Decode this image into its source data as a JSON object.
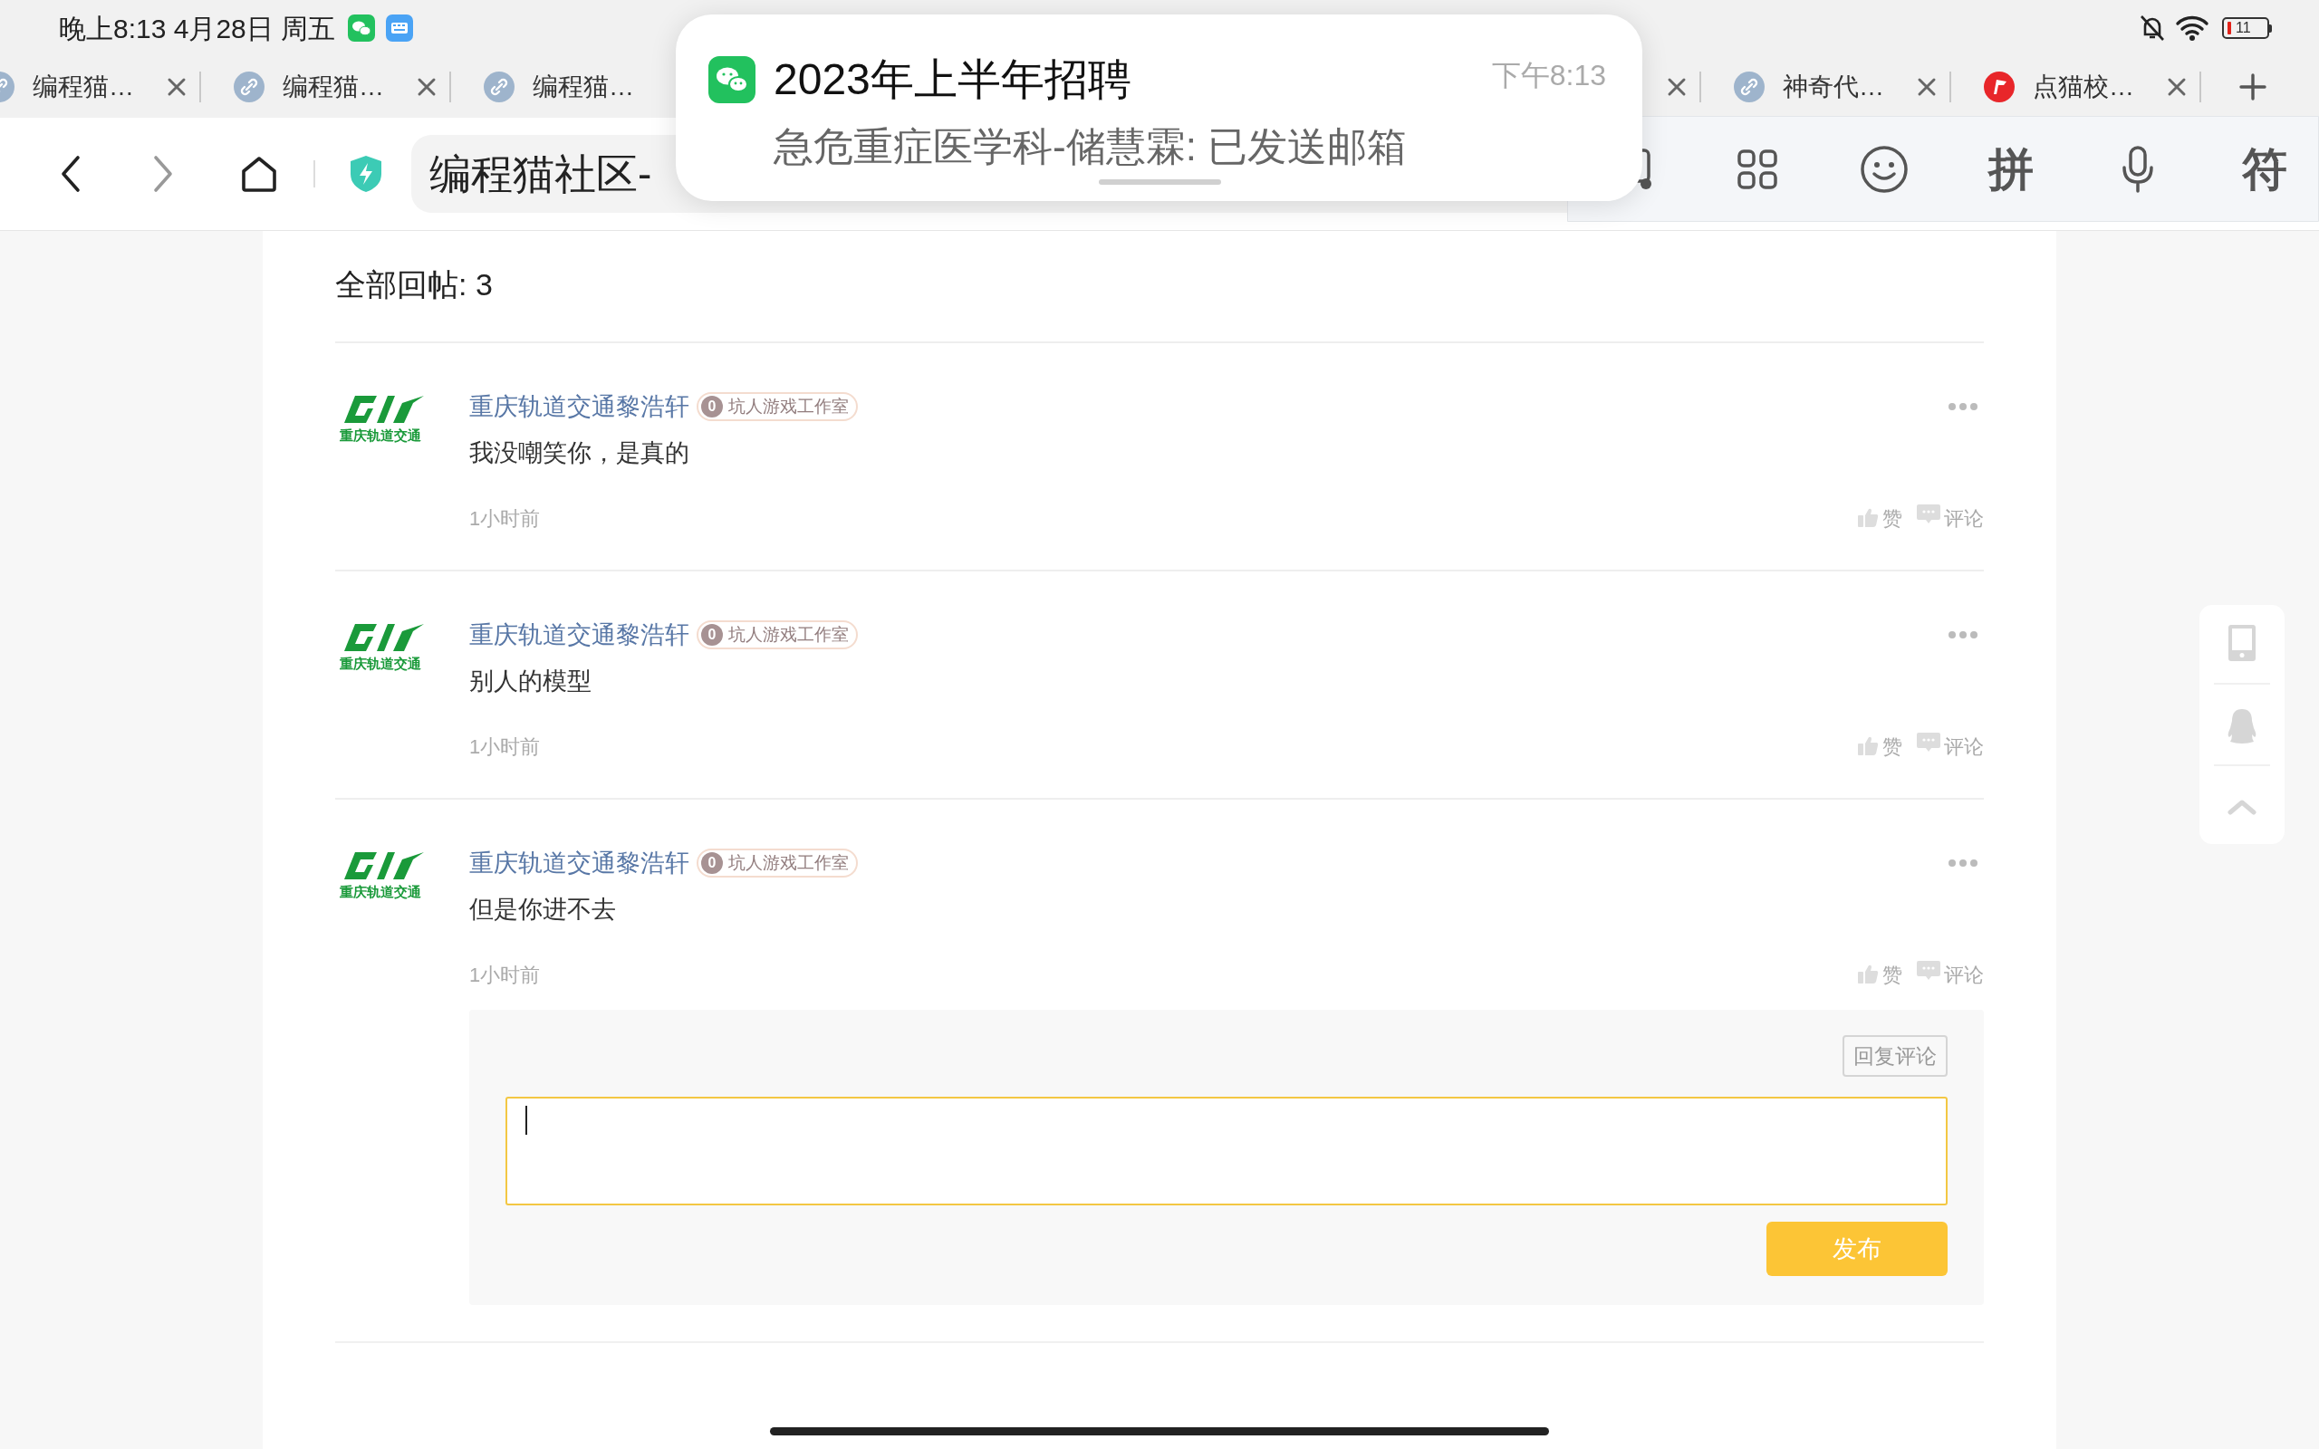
{
  "status_bar": {
    "time": "晚上8:13 4月28日 周五",
    "battery": "11"
  },
  "tabs": [
    {
      "kind": "link",
      "title": "编程猫…"
    },
    {
      "kind": "link",
      "title": "编程猫…"
    },
    {
      "kind": "link",
      "title": "编程猫…"
    },
    {
      "kind": "covered"
    },
    {
      "kind": "link",
      "title": "神奇代…"
    },
    {
      "kind": "app",
      "title": "点猫校…"
    }
  ],
  "toolbar": {
    "address": "编程猫社区-"
  },
  "ime_bar": [
    {
      "kind": "keyboard"
    },
    {
      "kind": "grid"
    },
    {
      "kind": "emoji"
    },
    {
      "kind": "text",
      "label": "拼"
    },
    {
      "kind": "mic"
    },
    {
      "kind": "text",
      "label": "符"
    }
  ],
  "notification": {
    "title": "2023年上半年招聘",
    "time": "下午8:13",
    "message": "急危重症医学科-储慧霖: 已发送邮箱"
  },
  "page": {
    "heading": "全部回帖: 3",
    "comments": [
      {
        "avatar_caption": "重庆轨道交通",
        "author": "重庆轨道交通黎浩轩",
        "badge_level": "0",
        "badge": "坑人游戏工作室",
        "text": "我没嘲笑你，是真的",
        "time": "1小时前",
        "like": "赞",
        "comment": "评论"
      },
      {
        "avatar_caption": "重庆轨道交通",
        "author": "重庆轨道交通黎浩轩",
        "badge_level": "0",
        "badge": "坑人游戏工作室",
        "text": "别人的模型",
        "time": "1小时前",
        "like": "赞",
        "comment": "评论"
      },
      {
        "avatar_caption": "重庆轨道交通",
        "author": "重庆轨道交通黎浩轩",
        "badge_level": "0",
        "badge": "坑人游戏工作室",
        "text": "但是你进不去",
        "time": "1小时前",
        "like": "赞",
        "comment": "评论"
      }
    ],
    "reply": {
      "tag": "回复评论",
      "submit": "发布"
    }
  }
}
